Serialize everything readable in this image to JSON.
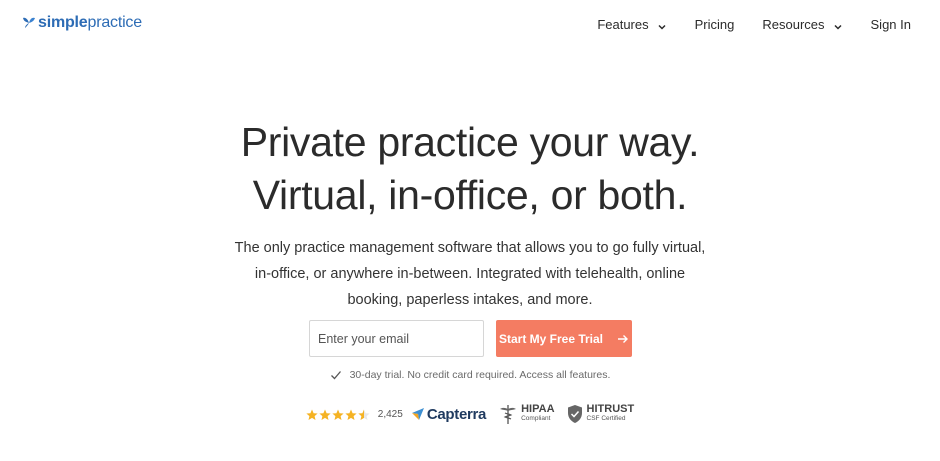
{
  "header": {
    "logo": {
      "simple": "simple",
      "practice": "practice",
      "icon": "butterfly-icon"
    },
    "nav": [
      {
        "label": "Features",
        "has_dropdown": true
      },
      {
        "label": "Pricing",
        "has_dropdown": false
      },
      {
        "label": "Resources",
        "has_dropdown": true
      },
      {
        "label": "Sign In",
        "has_dropdown": false
      }
    ]
  },
  "hero": {
    "title_line1": "Private practice your way.",
    "title_line2": "Virtual, in-office, or both.",
    "subtitle_line1": "The only practice management software that allows you to go fully virtual,",
    "subtitle_line2": "in-office, or anywhere in-between. Integrated with telehealth, online",
    "subtitle_line3": "booking, paperless intakes, and more."
  },
  "form": {
    "email_placeholder": "Enter your email",
    "email_value": "",
    "cta_label": "Start My Free Trial"
  },
  "trial_note": "30-day trial. No credit card required. Access all features.",
  "badges": {
    "rating_stars": 4.5,
    "rating_count": "2,425",
    "capterra": "Capterra",
    "hipaa_main": "HIPAA",
    "hipaa_sub": "Compliant",
    "hitrust_main": "HITRUST",
    "hitrust_sub": "CSF Certified"
  },
  "colors": {
    "brand_blue": "#2d6cb5",
    "cta_orange": "#f47c62",
    "star_gold": "#f5b324",
    "text_dark": "#2b2b2b"
  }
}
